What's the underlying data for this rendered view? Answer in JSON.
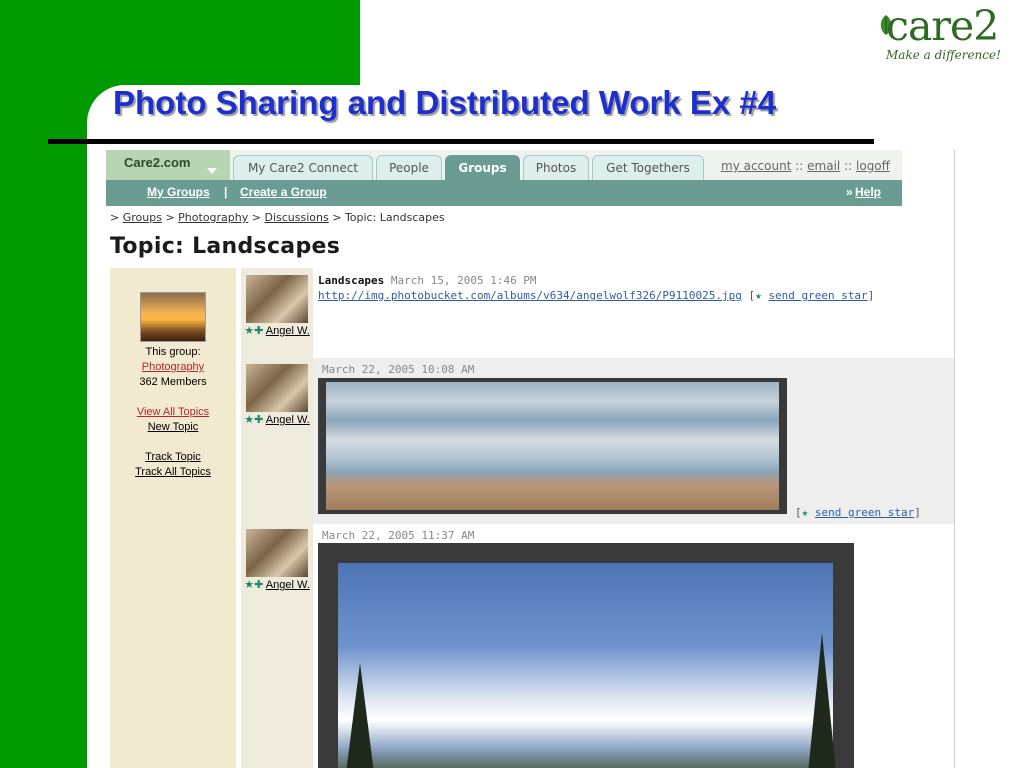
{
  "slide": {
    "title": "Photo Sharing and Distributed Work Ex #4",
    "logo": {
      "text": "care2",
      "tagline": "Make a difference!"
    },
    "colors": {
      "green": "#009900",
      "title": "#1d2fcf"
    }
  },
  "screenshot": {
    "brand": "Care2.com",
    "tabs": [
      "My Care2 Connect",
      "People",
      "Groups",
      "Photos",
      "Get Togethers"
    ],
    "active_tab": "Groups",
    "account_links": {
      "my_account": "my account",
      "sep": "::",
      "email": "email",
      "logoff": "logoff"
    },
    "subnav": {
      "my_groups": "My Groups",
      "sep": "|",
      "create_group": "Create a Group",
      "help_prefix": "»",
      "help": "Help"
    },
    "breadcrumb": {
      "prefix": ">",
      "groups": "Groups",
      "photography": "Photography",
      "discussions": "Discussions",
      "current": "Topic: Landscapes"
    },
    "topic_heading": "Topic: Landscapes",
    "sidebar": {
      "this_group": "This group:",
      "group_name": "Photography",
      "members": "362 Members",
      "view_all_topics": "View All Topics",
      "new_topic": "New Topic",
      "track_topic": "Track Topic",
      "track_all_topics": "Track All Topics"
    },
    "posts": [
      {
        "author": "Angel W.",
        "title": "Landscapes",
        "date": "March 15, 2005 1:46 PM",
        "link": "http://img.photobucket.com/albums/v634/angelwolf326/P9110025.jpg",
        "send_star": "send green star"
      },
      {
        "author": "Angel W.",
        "date": "March 22, 2005 10:08 AM",
        "send_star": "send green star"
      },
      {
        "author": "Angel W.",
        "date": "March 22, 2005 11:37 AM"
      }
    ]
  }
}
